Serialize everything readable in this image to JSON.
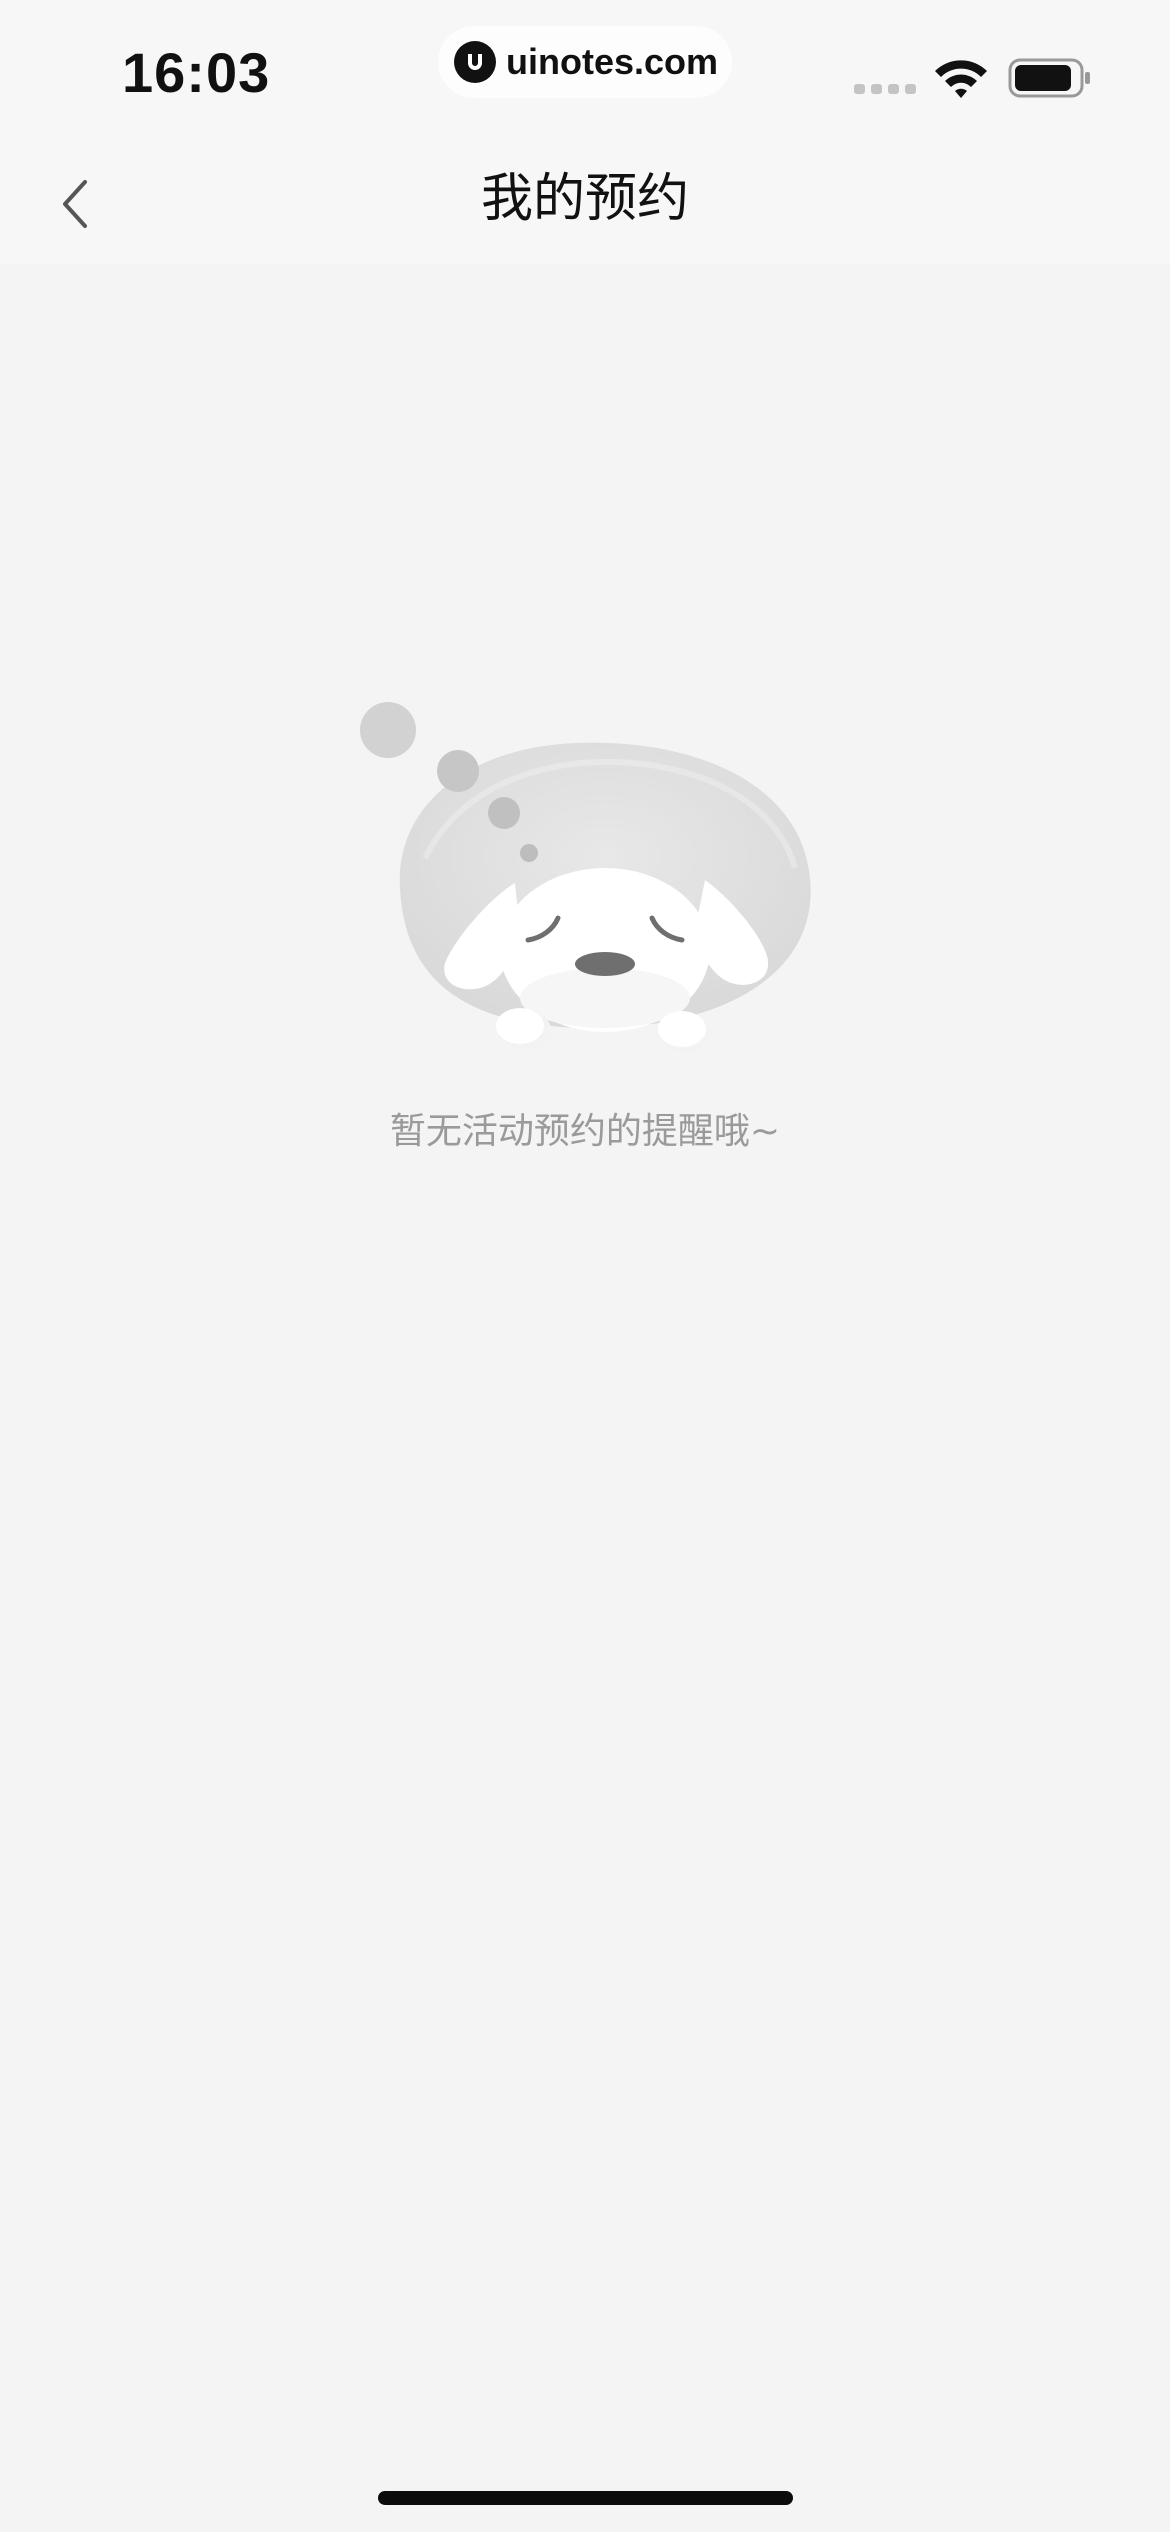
{
  "status_bar": {
    "time": "16:03",
    "watermark": "uinotes.com"
  },
  "nav": {
    "title": "我的预约",
    "back_icon": "chevron-left-icon"
  },
  "empty_state": {
    "illustration": "sleeping-dog-illustration",
    "message": "暂无活动预约的提醒哦~"
  },
  "colors": {
    "background": "#f4f4f4",
    "nav_background": "#f7f7f7",
    "title": "#111111",
    "message": "#9a9a9a"
  }
}
